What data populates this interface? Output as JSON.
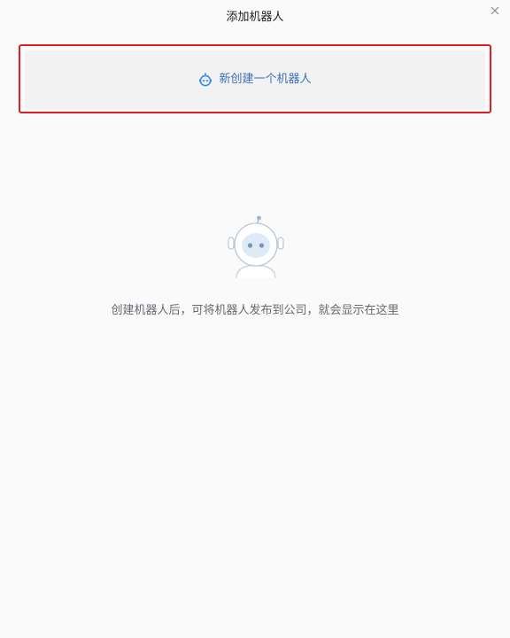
{
  "dialog": {
    "title": "添加机器人",
    "close_icon": "close-icon"
  },
  "create_button": {
    "label": "新创建一个机器人",
    "icon": "robot-icon",
    "highlight_color": "#e02020",
    "label_color": "#3a6fb5"
  },
  "empty_state": {
    "illustration": "robot-illustration",
    "message": "创建机器人后，可将机器人发布到公司，就会显示在这里"
  }
}
